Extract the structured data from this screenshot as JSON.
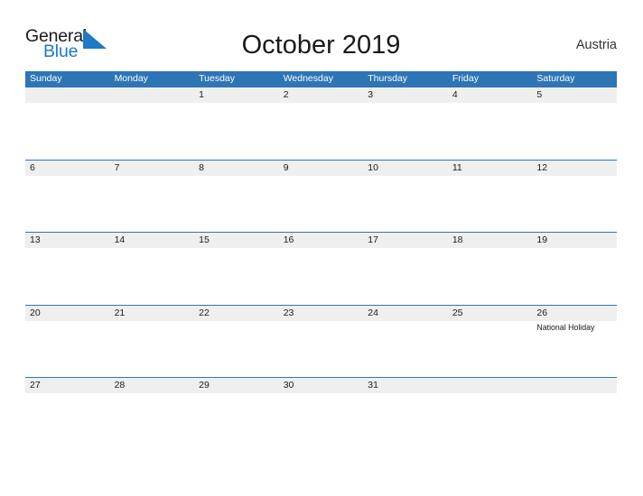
{
  "brand": {
    "name_part1": "General",
    "name_part2": "Blue",
    "triangle_color": "#1d7ac4",
    "text_color": "#1a1a1a"
  },
  "header": {
    "title": "October 2019",
    "region": "Austria"
  },
  "theme": {
    "header_blue": "#2E75B6",
    "band_gray": "#EFEFEF",
    "page_background": "#FFFFFF",
    "text": "#1A1A1A",
    "header_text": "#FFFFFF"
  },
  "calendar": {
    "month": "October",
    "year": "2019",
    "day_headers": [
      "Sunday",
      "Monday",
      "Tuesday",
      "Wednesday",
      "Thursday",
      "Friday",
      "Saturday"
    ],
    "weeks": [
      [
        {
          "date": "",
          "event": ""
        },
        {
          "date": "",
          "event": ""
        },
        {
          "date": "1",
          "event": ""
        },
        {
          "date": "2",
          "event": ""
        },
        {
          "date": "3",
          "event": ""
        },
        {
          "date": "4",
          "event": ""
        },
        {
          "date": "5",
          "event": ""
        }
      ],
      [
        {
          "date": "6",
          "event": ""
        },
        {
          "date": "7",
          "event": ""
        },
        {
          "date": "8",
          "event": ""
        },
        {
          "date": "9",
          "event": ""
        },
        {
          "date": "10",
          "event": ""
        },
        {
          "date": "11",
          "event": ""
        },
        {
          "date": "12",
          "event": ""
        }
      ],
      [
        {
          "date": "13",
          "event": ""
        },
        {
          "date": "14",
          "event": ""
        },
        {
          "date": "15",
          "event": ""
        },
        {
          "date": "16",
          "event": ""
        },
        {
          "date": "17",
          "event": ""
        },
        {
          "date": "18",
          "event": ""
        },
        {
          "date": "19",
          "event": ""
        }
      ],
      [
        {
          "date": "20",
          "event": ""
        },
        {
          "date": "21",
          "event": ""
        },
        {
          "date": "22",
          "event": ""
        },
        {
          "date": "23",
          "event": ""
        },
        {
          "date": "24",
          "event": ""
        },
        {
          "date": "25",
          "event": ""
        },
        {
          "date": "26",
          "event": "National Holiday"
        }
      ],
      [
        {
          "date": "27",
          "event": ""
        },
        {
          "date": "28",
          "event": ""
        },
        {
          "date": "29",
          "event": ""
        },
        {
          "date": "30",
          "event": ""
        },
        {
          "date": "31",
          "event": ""
        },
        {
          "date": "",
          "event": ""
        },
        {
          "date": "",
          "event": ""
        }
      ]
    ]
  }
}
